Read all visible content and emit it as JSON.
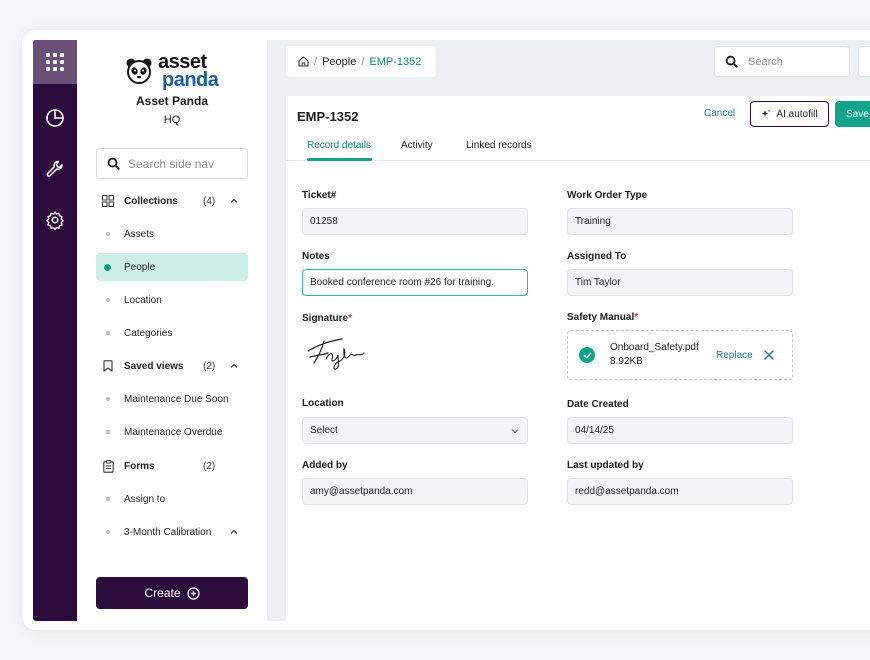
{
  "brand": {
    "logo_line1": "asset",
    "logo_line2": "panda",
    "org_name": "Asset Panda",
    "org_sub": "HQ"
  },
  "rail": {
    "icons": [
      "grid-apps-icon",
      "pie-chart-icon",
      "wrench-icon",
      "gear-icon"
    ]
  },
  "sidenav": {
    "search_placeholder": "Search side nav",
    "collections": {
      "label": "Collections",
      "count": "(4)"
    },
    "collection_items": [
      "Assets",
      "People",
      "Location",
      "Categories"
    ],
    "active_item": "People",
    "saved_views": {
      "label": "Saved views",
      "count": "(2)"
    },
    "saved_view_items": [
      "Maintenance Due Soon",
      "Maintenance Overdue"
    ],
    "forms": {
      "label": "Forms",
      "count": "(2)"
    },
    "form_items": [
      "Assign to",
      "3-Month Calibration"
    ],
    "create_label": "Create"
  },
  "topbar": {
    "breadcrumb_sep": "/",
    "breadcrumb_section": "People",
    "breadcrumb_current": "EMP-1352",
    "search_placeholder": "Search"
  },
  "record": {
    "title": "EMP-1352",
    "cancel_label": "Cancel",
    "ai_autofill_label": "AI autofill",
    "save_label": "Save",
    "tabs": [
      "Record details",
      "Activity",
      "Linked records"
    ],
    "active_tab": "Record details"
  },
  "form": {
    "ticket_label": "Ticket#",
    "ticket_value": "01258",
    "work_order_label": "Work Order Type",
    "work_order_value": "Training",
    "notes_label": "Notes",
    "notes_value": "Booked conference room #26 for training.",
    "assigned_label": "Assigned To",
    "assigned_value": "Tim Taylor",
    "signature_label": "Signature",
    "safety_label": "Safety Manual",
    "required_mark": "*",
    "file_name": "Onboard_Safety.pdf",
    "file_size": "8.92KB",
    "replace_label": "Replace",
    "location_label": "Location",
    "location_value": "Select",
    "date_label": "Date Created",
    "date_value": "04/14/25",
    "added_label": "Added by",
    "added_value": "amy@assetpanda.com",
    "updated_label": "Last updated by",
    "updated_value": "redd@assetpanda.com"
  },
  "colors": {
    "rail": "#2c0c3c",
    "accent": "#10a488",
    "active_nav": "#cdeee6",
    "link": "#1a7f9c"
  }
}
